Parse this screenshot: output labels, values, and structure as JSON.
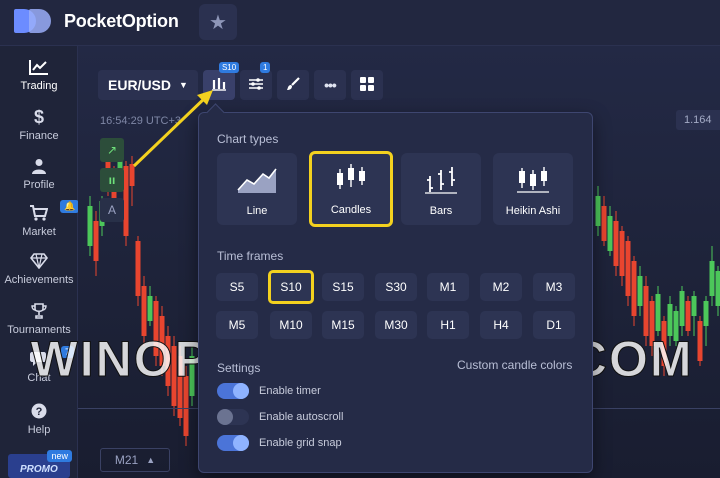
{
  "brand": {
    "name": "PocketOption"
  },
  "sidebar": {
    "items": [
      {
        "label": "Trading",
        "icon": "chart-line-icon"
      },
      {
        "label": "Finance",
        "icon": "dollar-icon"
      },
      {
        "label": "Profile",
        "icon": "user-icon"
      },
      {
        "label": "Market",
        "icon": "cart-icon"
      },
      {
        "label": "Achievements",
        "icon": "diamond-icon"
      },
      {
        "label": "Tournaments",
        "icon": "trophy-icon"
      },
      {
        "label": "Chat",
        "icon": "chat-icon",
        "badge": "7"
      },
      {
        "label": "Help",
        "icon": "help-icon"
      }
    ],
    "promo": {
      "label": "PROMO",
      "badge": "new"
    }
  },
  "toolbar": {
    "pair": "EUR/USD",
    "chart_type_badge": "S10",
    "indicators_badge": "1"
  },
  "chart": {
    "time": "16:54:29 UTC+3",
    "price": "1.164",
    "timeframe_selector": "M21",
    "left_tools": [
      "A"
    ]
  },
  "popup": {
    "chart_types_title": "Chart types",
    "chart_types": [
      {
        "label": "Line",
        "selected": false
      },
      {
        "label": "Candles",
        "selected": true
      },
      {
        "label": "Bars",
        "selected": false
      },
      {
        "label": "Heikin Ashi",
        "selected": false
      }
    ],
    "time_frames_title": "Time frames",
    "time_frames": [
      [
        "S5",
        "S10",
        "S15",
        "S30",
        "M1",
        "M2",
        "M3"
      ],
      [
        "M5",
        "M10",
        "M15",
        "M30",
        "H1",
        "H4",
        "D1"
      ]
    ],
    "selected_time_frame": "S10",
    "settings_title": "Settings",
    "custom_colors_label": "Custom candle colors",
    "toggles": [
      {
        "label": "Enable timer",
        "on": true
      },
      {
        "label": "Enable autoscroll",
        "on": false
      },
      {
        "label": "Enable grid snap",
        "on": true
      }
    ]
  },
  "watermark": "WINOPTIONCRYPTO.COM",
  "colors": {
    "accent": "#2f7be0",
    "highlight": "#f3d11f",
    "bull": "#4cc75a",
    "bear": "#e8452f"
  }
}
